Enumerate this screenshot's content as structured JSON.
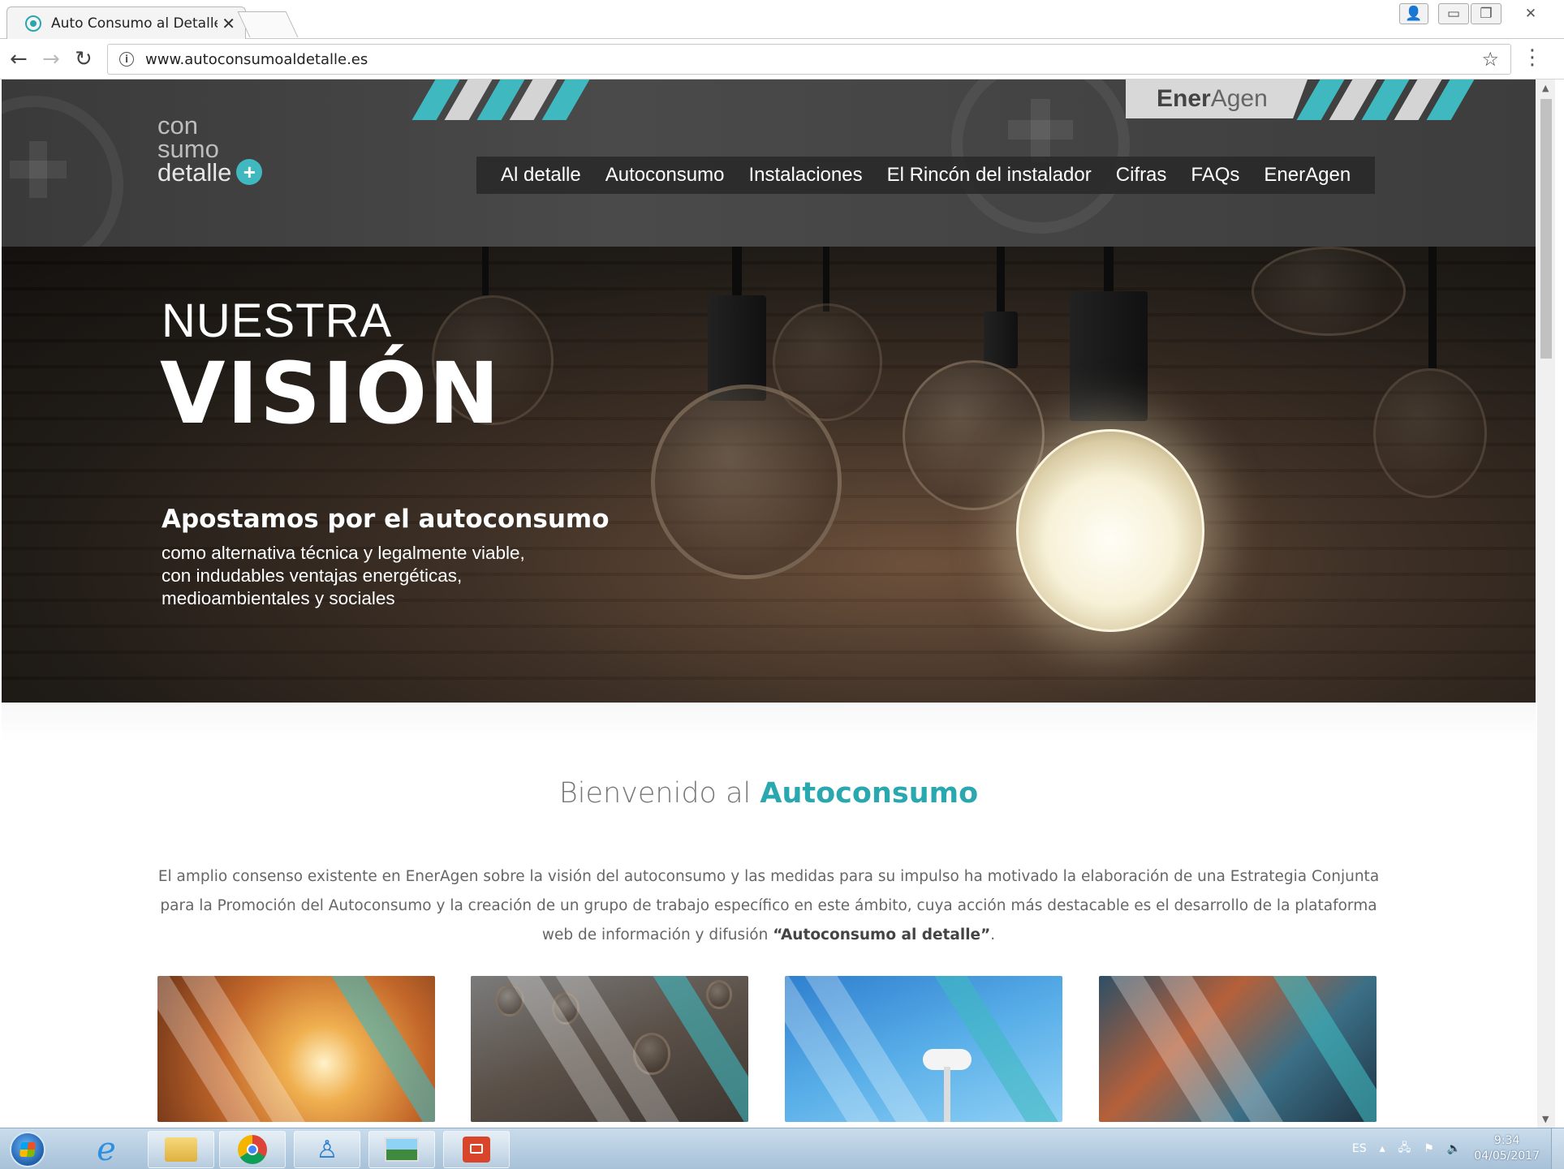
{
  "browser": {
    "tab_title": "Auto Consumo al Detalle",
    "url": "www.autoconsumoaldetalle.es"
  },
  "header": {
    "logo_line1": "con",
    "logo_line2": "sumo",
    "logo_line3": "detalle",
    "logo_plus": "+",
    "brand_bold": "Ener",
    "brand_light": "Agen",
    "nav": [
      "Al detalle",
      "Autoconsumo",
      "Instalaciones",
      "El Rincón del instalador",
      "Cifras",
      "FAQs",
      "EnerAgen"
    ]
  },
  "hero": {
    "title_top": "NUESTRA",
    "title_big": "VISIÓN",
    "subtitle": "Apostamos por el autoconsumo",
    "body_lines": [
      "como alternativa técnica y legalmente viable,",
      "con indudables ventajas energéticas,",
      "medioambientales y sociales"
    ]
  },
  "welcome": {
    "prefix": "Bienvenido al ",
    "accent": "Autoconsumo"
  },
  "intro": {
    "text": "El amplio consenso existente en EnerAgen sobre la visión del autoconsumo y las medidas para su impulso ha motivado la elaboración de una Estrategia Conjunta para la Promoción del Autoconsumo y la creación de un grupo de trabajo específico en este ámbito, cuya acción más destacable es el desarrollo de la plataforma web de información y difusión ",
    "highlight": "“Autoconsumo al detalle”",
    "end": "."
  },
  "cards": [
    "hand-light-image",
    "lightbulbs-image",
    "wind-turbine-image",
    "industrial-pipes-image"
  ],
  "taskbar": {
    "language": "ES",
    "time": "9:34",
    "date": "04/05/2017"
  },
  "colors": {
    "accent": "#3fb9bf",
    "header_bg": "#3a3a3a"
  }
}
